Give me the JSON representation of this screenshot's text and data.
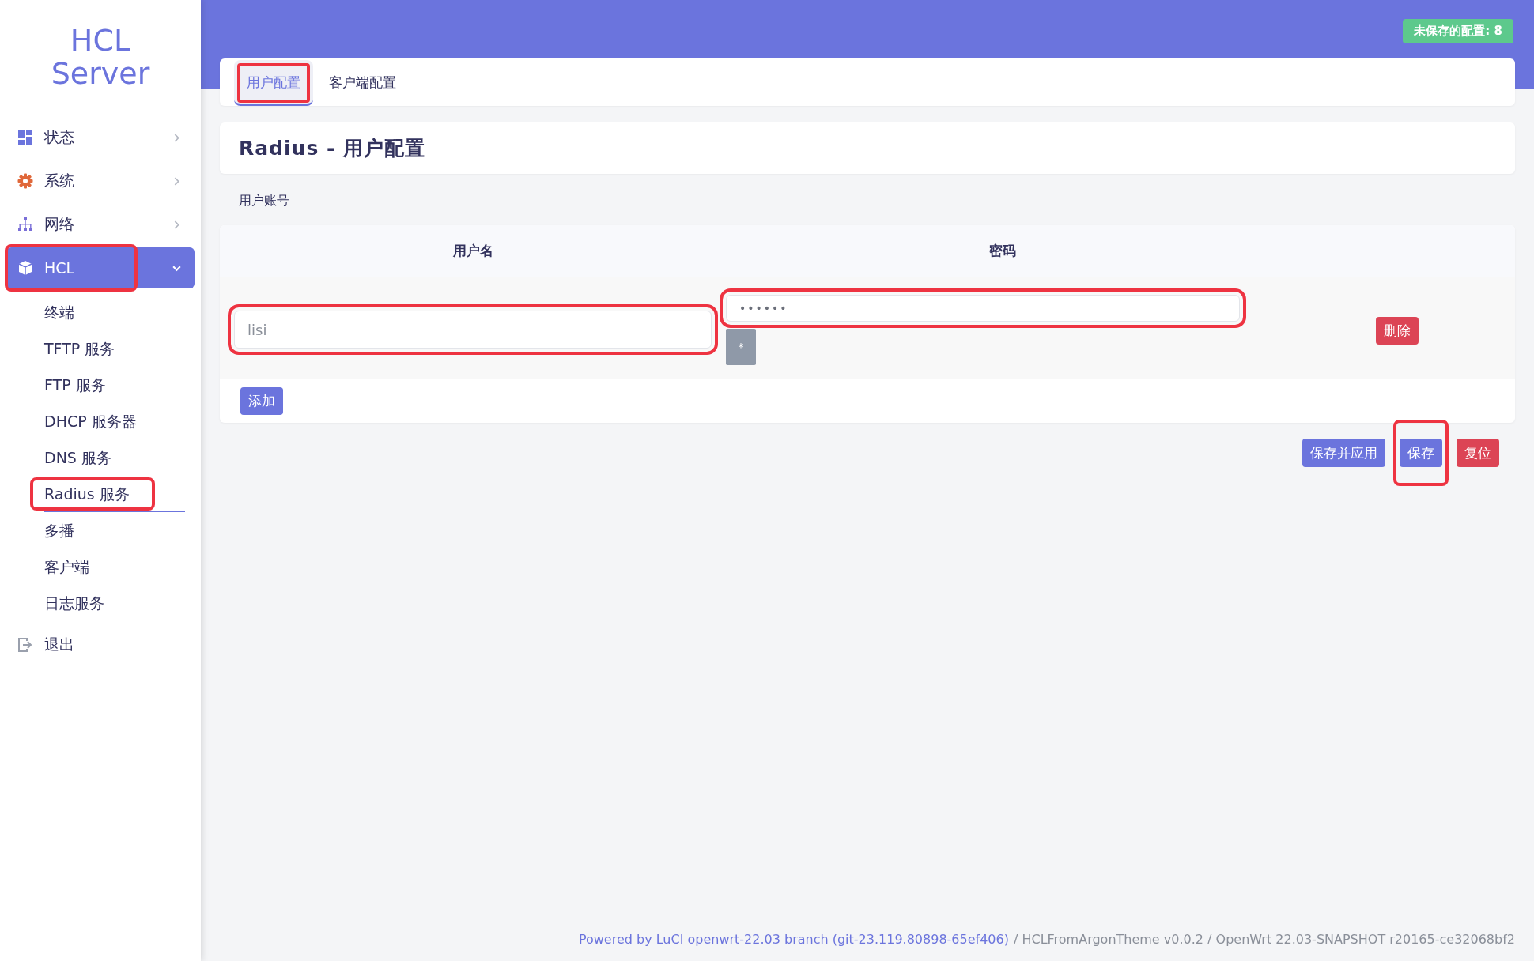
{
  "sidebar": {
    "brand": "HCL Server",
    "items": [
      {
        "label": "状态",
        "selected": false,
        "expanded": false,
        "annotated": false
      },
      {
        "label": "系统",
        "selected": false,
        "expanded": false,
        "annotated": false
      },
      {
        "label": "网络",
        "selected": false,
        "expanded": false,
        "annotated": false
      },
      {
        "label": "HCL",
        "selected": true,
        "expanded": true,
        "annotated": true,
        "children": [
          {
            "label": "终端",
            "selected": false,
            "annotated": false
          },
          {
            "label": "TFTP 服务",
            "selected": false,
            "annotated": false
          },
          {
            "label": "FTP 服务",
            "selected": false,
            "annotated": false
          },
          {
            "label": "DHCP 服务器",
            "selected": false,
            "annotated": false
          },
          {
            "label": "DNS 服务",
            "selected": false,
            "annotated": false
          },
          {
            "label": "Radius 服务",
            "selected": true,
            "annotated": true
          },
          {
            "label": "多播",
            "selected": false,
            "annotated": false
          },
          {
            "label": "客户端",
            "selected": false,
            "annotated": false
          },
          {
            "label": "日志服务",
            "selected": false,
            "annotated": false
          }
        ]
      },
      {
        "label": "退出",
        "selected": false,
        "annotated": false
      }
    ]
  },
  "unsaved_badge": "未保存的配置: 8",
  "tabs": [
    {
      "label": "用户配置",
      "selected": true,
      "annotated": true
    },
    {
      "label": "客户端配置",
      "selected": false,
      "annotated": false
    }
  ],
  "section_title": "Radius - 用户配置",
  "table": {
    "caption": "用户账号",
    "columns": [
      "用户名",
      "密码"
    ],
    "rows": [
      {
        "username": "lisi",
        "username_annotated": true,
        "password": "••••••",
        "password_annotated": true,
        "reveal_button": "*",
        "delete_button": "删除"
      }
    ],
    "add_button": "添加"
  },
  "actions": [
    {
      "label": "保存并应用",
      "kind": "primary",
      "annotated": false
    },
    {
      "label": "保存",
      "kind": "primary",
      "annotated": true
    },
    {
      "label": "复位",
      "kind": "danger",
      "annotated": false
    }
  ],
  "footer": {
    "link": "Powered by LuCI openwrt-22.03 branch (git-23.119.80898-65ef406)",
    "text": "/ HCLFromArgonTheme v0.0.2 / OpenWrt 22.03-SNAPSHOT r20165-ce32068bf2"
  }
}
